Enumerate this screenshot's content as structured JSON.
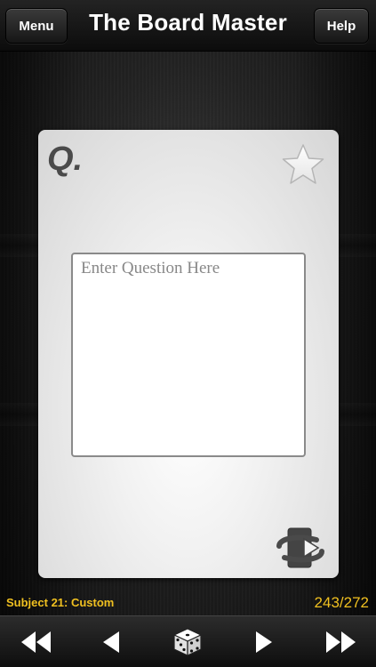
{
  "header": {
    "menu_label": "Menu",
    "title": "The Board Master",
    "help_label": "Help"
  },
  "card": {
    "side_label": "Q.",
    "question_placeholder": "Enter Question Here",
    "question_value": "",
    "favorite_icon": "star-icon",
    "flip_icon": "flip-card-icon"
  },
  "status": {
    "subject": "Subject 21: Custom",
    "position": "243/272"
  },
  "toolbar": {
    "icons": [
      "rewind-icon",
      "previous-icon",
      "dice-icon",
      "next-icon",
      "fast-forward-icon"
    ]
  },
  "colors": {
    "accent": "#f0c020",
    "card_label": "#4a4a4a",
    "header_bg": "#161616"
  }
}
